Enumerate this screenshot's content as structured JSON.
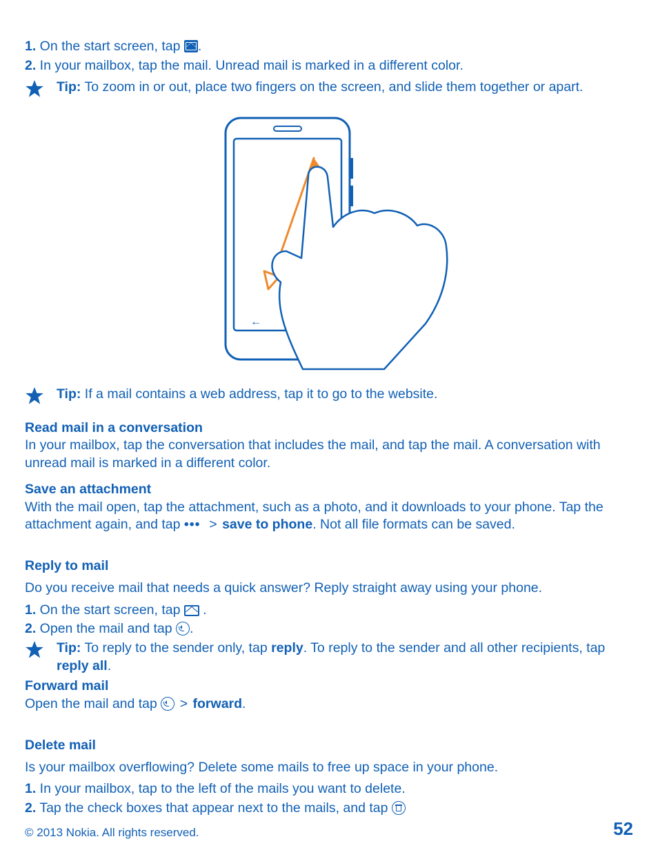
{
  "steps1": {
    "s1_num": "1.",
    "s1_text_a": " On the start screen, tap ",
    "s1_text_b": ".",
    "s2_num": "2.",
    "s2_text": " In your mailbox, tap the mail. Unread mail is marked in a different color."
  },
  "tip1": {
    "label": "Tip:",
    "text": " To zoom in or out, place two fingers on the screen, and slide them together or apart."
  },
  "tip2": {
    "label": "Tip:",
    "text": " If a mail contains a web address, tap it to go to the website."
  },
  "read_conv": {
    "title": "Read mail in a conversation",
    "body": "In your mailbox, tap the conversation that includes the mail, and tap the mail. A conversation with unread mail is marked in a different color."
  },
  "save_att": {
    "title": "Save an attachment",
    "body_a": "With the mail open, tap the attachment, such as a photo, and it downloads to your phone. Tap the attachment again, and tap  ",
    "gt": ">",
    "save_label": "save to phone",
    "body_b": ". Not all file formats can be saved."
  },
  "reply": {
    "title": "Reply to mail",
    "intro": "Do you receive mail that needs a quick answer? Reply straight away using your phone.",
    "s1_num": "1.",
    "s1_a": " On the start screen, tap ",
    "s1_b": " .",
    "s2_num": "2.",
    "s2_a": " Open the mail and tap ",
    "s2_b": "."
  },
  "tip3": {
    "label": "Tip:",
    "text_a": " To reply to the sender only, tap ",
    "reply": "reply",
    "text_b": ". To reply to the sender and all other recipients, tap ",
    "reply_all": "reply all",
    "text_c": "."
  },
  "forward": {
    "title": "Forward mail",
    "body_a": "Open the mail and tap ",
    "gt": ">",
    "fwd": "forward",
    "body_b": "."
  },
  "delete": {
    "title": "Delete mail",
    "intro": "Is your mailbox overflowing? Delete some mails to free up space in your phone.",
    "s1_num": "1.",
    "s1": " In your mailbox, tap to the left of the mails you want to delete.",
    "s2_num": "2.",
    "s2_a": " Tap the check boxes that appear next to the mails, and tap "
  },
  "footer": {
    "copyright": "© 2013 Nokia. All rights reserved.",
    "page": "52"
  }
}
